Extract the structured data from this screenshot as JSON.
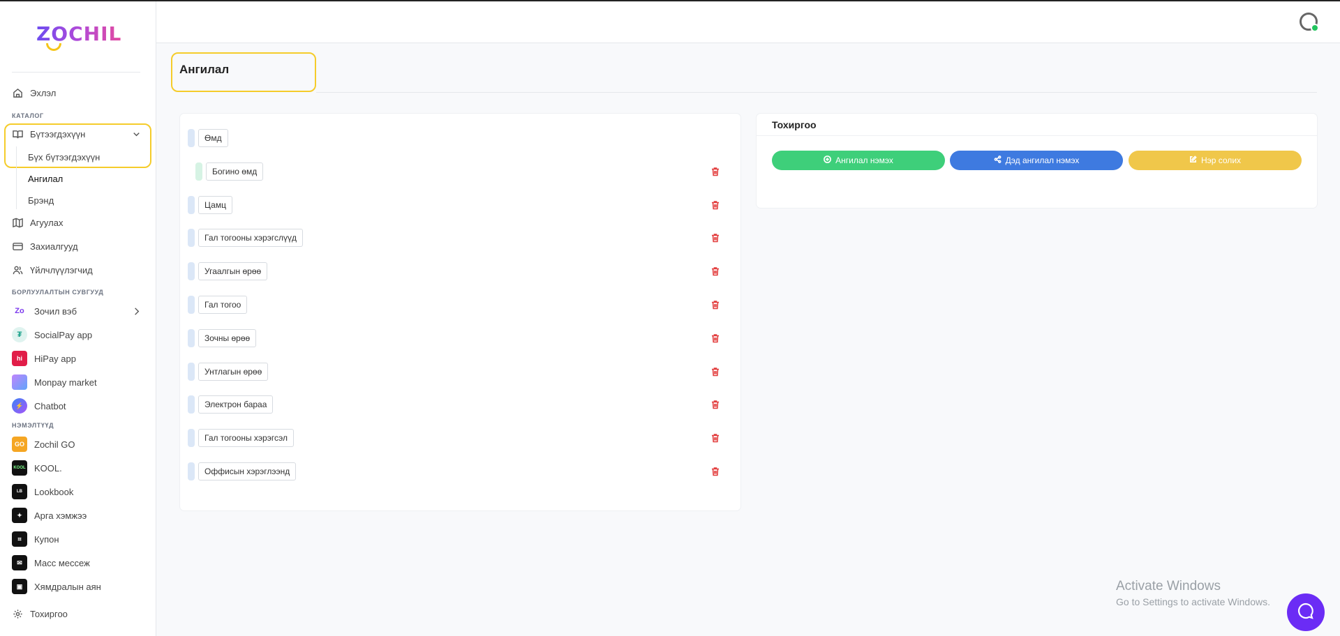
{
  "brand": {
    "logo_text": "ZOCHIL"
  },
  "sidebar": {
    "home": "Эхлэл",
    "catalog_label": "КАТАЛОГ",
    "products": "Бүтээгдэхүүн",
    "products_sub": [
      "Бүх бүтээгдэхүүн",
      "Ангилал",
      "Брэнд"
    ],
    "warehouse": "Агуулах",
    "orders": "Захиалгууд",
    "customers": "Үйлчлүүлэгчид",
    "sales_channels_label": "БОРЛУУЛАЛТЫН СУВГУУД",
    "channels": [
      "Зочил вэб",
      "SocialPay app",
      "HiPay app",
      "Monpay market",
      "Chatbot"
    ],
    "addons_label": "НЭМЭЛТҮҮД",
    "addons": [
      "Zochil GO",
      "KOOL.",
      "Lookbook",
      "Арга хэмжээ",
      "Купон",
      "Масс мессеж",
      "Хямдралын аян"
    ],
    "settings": "Тохиргоо"
  },
  "page": {
    "title": "Ангилал"
  },
  "categories": [
    {
      "label": "Өмд",
      "level": 0,
      "deletable": false
    },
    {
      "label": "Богино өмд",
      "level": 1,
      "deletable": true
    },
    {
      "label": "Цамц",
      "level": 0,
      "deletable": true
    },
    {
      "label": "Гал тогооны хэрэгслүүд",
      "level": 0,
      "deletable": true
    },
    {
      "label": "Угаалгын өрөө",
      "level": 0,
      "deletable": true
    },
    {
      "label": "Гал тогоо",
      "level": 0,
      "deletable": true
    },
    {
      "label": "Зочны өрөө",
      "level": 0,
      "deletable": true
    },
    {
      "label": "Унтлагын өрөө",
      "level": 0,
      "deletable": true
    },
    {
      "label": "Электрон бараа",
      "level": 0,
      "deletable": true
    },
    {
      "label": "Гал тогооны хэрэгсэл",
      "level": 0,
      "deletable": true
    },
    {
      "label": "Оффисын хэрэглээнд",
      "level": 0,
      "deletable": true
    }
  ],
  "settings_panel": {
    "title": "Тохиргоо",
    "add_category": "Ангилал нэмэх",
    "add_subcategory": "Дэд ангилал нэмэх",
    "rename": "Нэр солих"
  },
  "colors": {
    "green": "#3ecf7a",
    "blue": "#3e7ae0",
    "yellow": "#f0c74a",
    "accent_yellow": "#f5cc2a",
    "purple": "#6b2cf5"
  },
  "watermark": {
    "line1": "Activate Windows",
    "line2": "Go to Settings to activate Windows."
  }
}
